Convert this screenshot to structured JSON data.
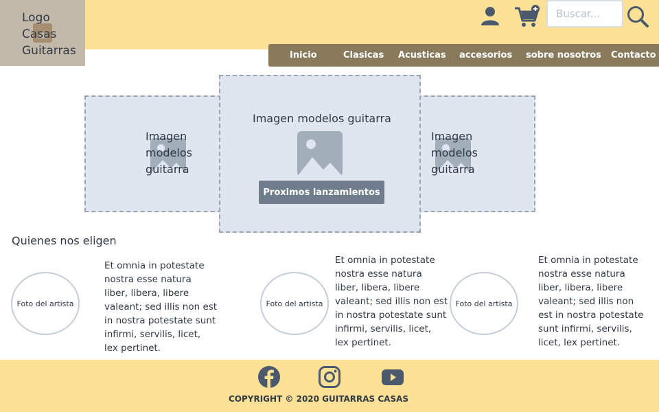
{
  "logo": {
    "text": "Logo\nCasas\nGuitarras",
    "image_icon": "image-icon"
  },
  "header": {
    "user_icon": "user-icon",
    "cart_icon": "cart-add-icon",
    "search_placeholder": "Buscar...",
    "search_icon": "search-icon"
  },
  "nav": {
    "items": [
      {
        "label": "Inicio"
      },
      {
        "label": "Clasicas"
      },
      {
        "label": "Acusticas"
      },
      {
        "label": "accesorios"
      },
      {
        "label": "sobre nosotros"
      },
      {
        "label": "Contacto"
      }
    ]
  },
  "carousel": {
    "left_caption": "Imagen\nmodelos\nguitarra",
    "center_caption": "Imagen modelos guitarra",
    "right_caption": "Imagen\nmodelos\nguitarra",
    "cta_label": "Proximos lanzamientos"
  },
  "testimonials": {
    "title": "Quienes nos eligen",
    "items": [
      {
        "avatar_label": "Foto del artista",
        "text": "Et omnia in potestate\nnostra esse natura\nliber, libera, libere\nvaleant; sed illis non est\nin nostra potestate sunt\ninfirmi, servilis, licet,\nlex pertinet."
      },
      {
        "avatar_label": "Foto del artista",
        "text": "Et omnia in potestate\nnostra esse natura\nliber, libera, libere\nvaleant; sed illis non est\nin nostra potestate sunt\ninfirmi, servilis, licet,\nlex pertinet."
      },
      {
        "avatar_label": "Foto del artista",
        "text": "Et omnia in potestate\nnostra esse natura\nliber, libera, libere\nvaleant; sed illis non\nest in nostra potestate\nsunt infirmi, servilis,\nlicet, lex pertinet."
      }
    ]
  },
  "footer": {
    "social": [
      "facebook-icon",
      "instagram-icon",
      "youtube-icon"
    ],
    "copyright": "COPYRIGHT © 2020 GUITARRAS CASAS"
  },
  "colors": {
    "header_bg": "#fce196",
    "nav_bg": "#8a7a5c",
    "slide_bg": "#e0e6ef",
    "cta_bg": "#6f7c8b",
    "icon": "#4a5a6c"
  }
}
